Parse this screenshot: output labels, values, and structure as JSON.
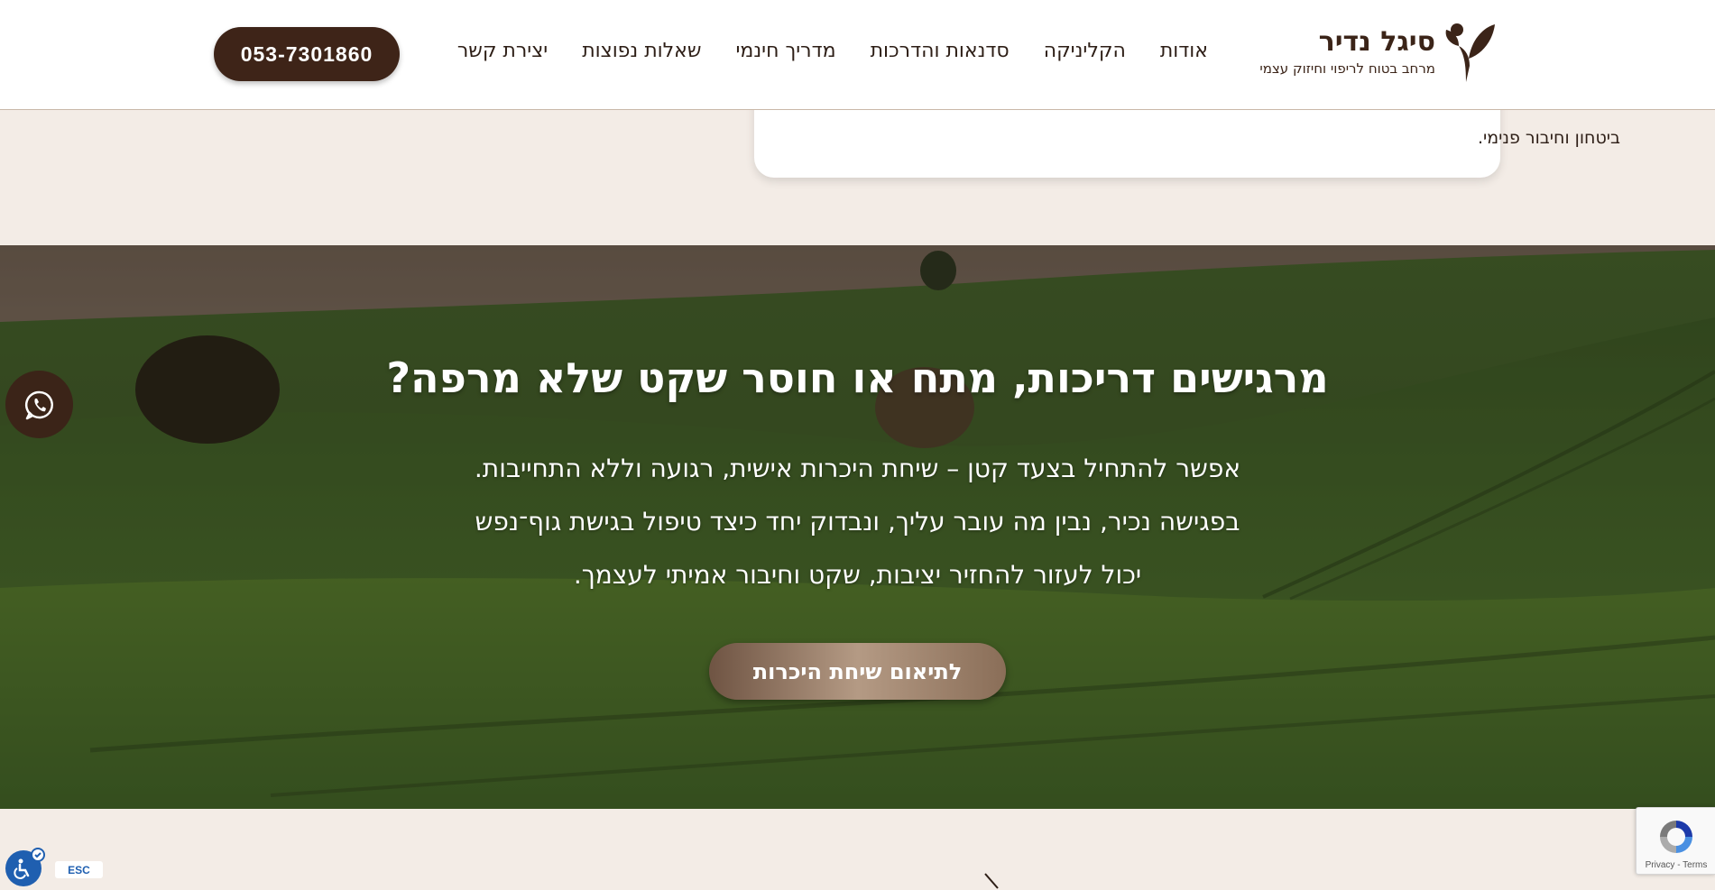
{
  "header": {
    "logo": {
      "title": "סיגל נדיר",
      "subtitle": "מרחב בטוח לריפוי וחיזוק עצמי"
    },
    "nav": [
      {
        "label": "אודות"
      },
      {
        "label": "הקליניקה"
      },
      {
        "label": "סדנאות והדרכות"
      },
      {
        "label": "מדריך חינמי"
      },
      {
        "label": "שאלות נפוצות"
      },
      {
        "label": "יצירת קשר"
      }
    ],
    "phone": "053-7301860"
  },
  "card": {
    "last_line": "ביטחון וחיבור פנימי."
  },
  "hero": {
    "title": "מרגישים דריכות, מתח או חוסר שקט שלא מרפה?",
    "body_lines": [
      "אפשר להתחיל בצעד קטן – שיחת היכרות אישית, רגועה וללא התחייבות.",
      "בפגישה נכיר, נבין מה עובר עליך, ונבדוק יחד כיצד טיפול בגישת גוף־נפש",
      "יכול לעזור להחזיר יציבות, שקט וחיבור אמיתי לעצמך."
    ],
    "cta": "לתיאום שיחת היכרות"
  },
  "widgets": {
    "whatsapp_icon": "whatsapp-icon",
    "accessibility_icon": "accessibility-icon",
    "esc_label": "ESC",
    "recaptcha_text": "Privacy - Terms"
  },
  "colors": {
    "brand_dark": "#3e2418",
    "cta_light": "#b49a84",
    "page_bg": "#f3ece6"
  }
}
